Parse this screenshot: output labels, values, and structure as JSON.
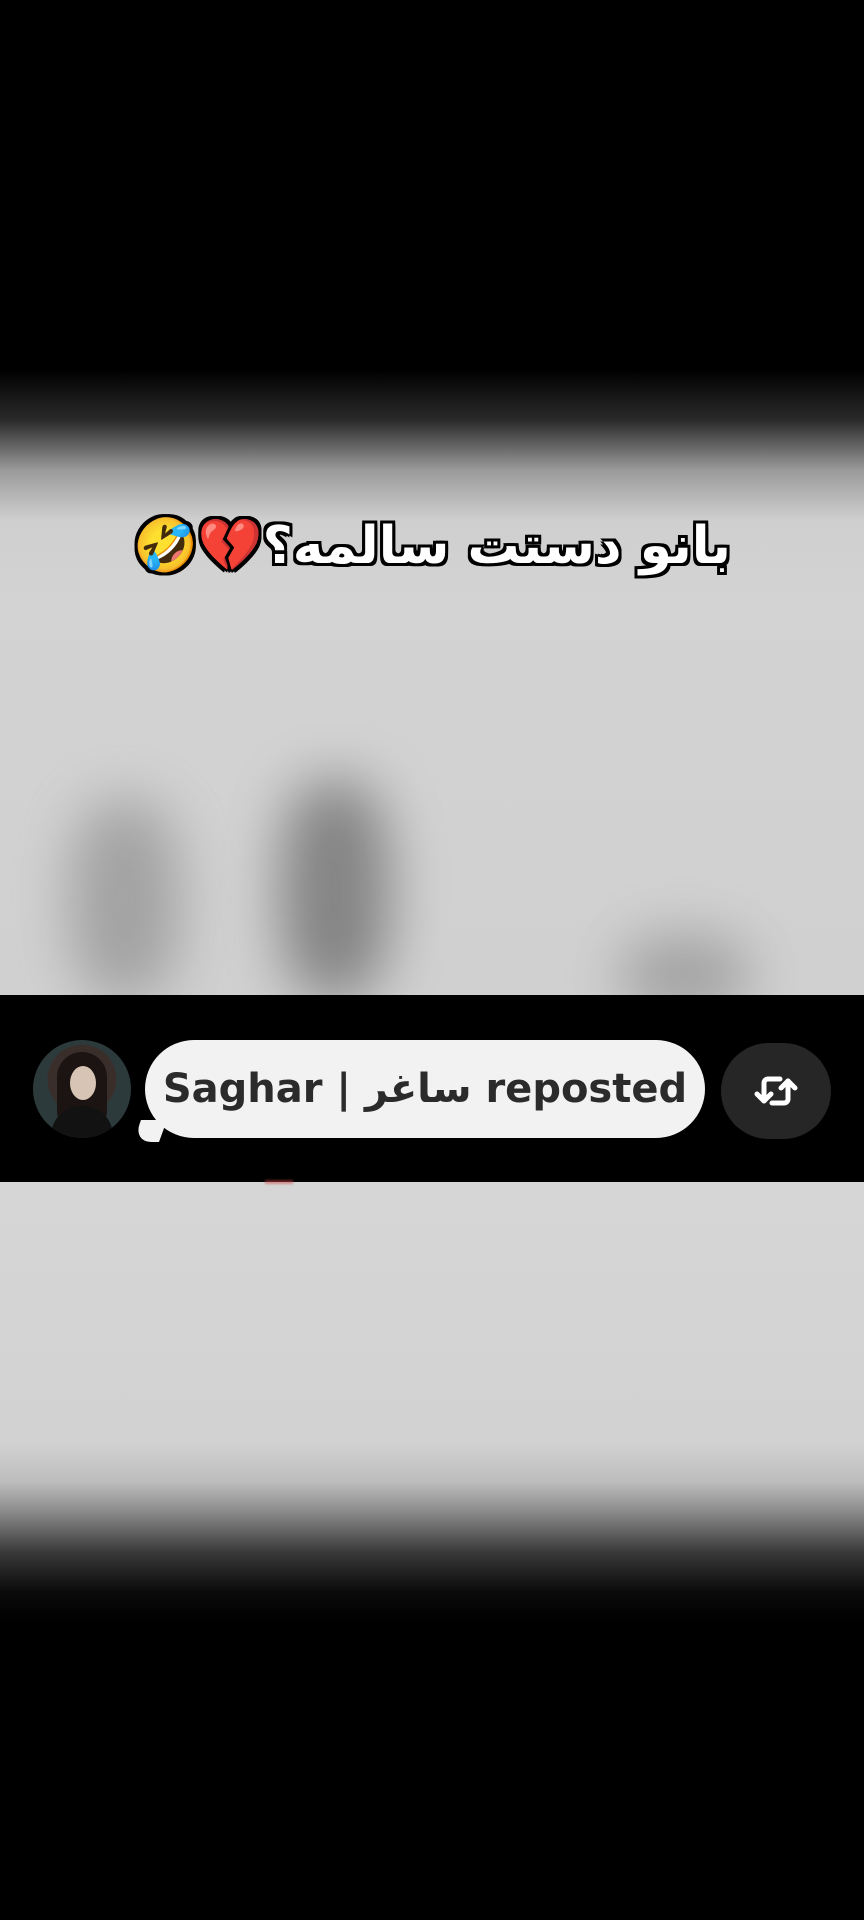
{
  "caption": {
    "text": "بانو دستت سالمه؟💔🤣"
  },
  "repost_notification": {
    "text": "Saghar | ساغر reposted",
    "icon": "repost-icon"
  },
  "colors": {
    "bubble_bg": "#f2f2f2",
    "repost_button_bg": "#262626",
    "background": "#000000"
  }
}
